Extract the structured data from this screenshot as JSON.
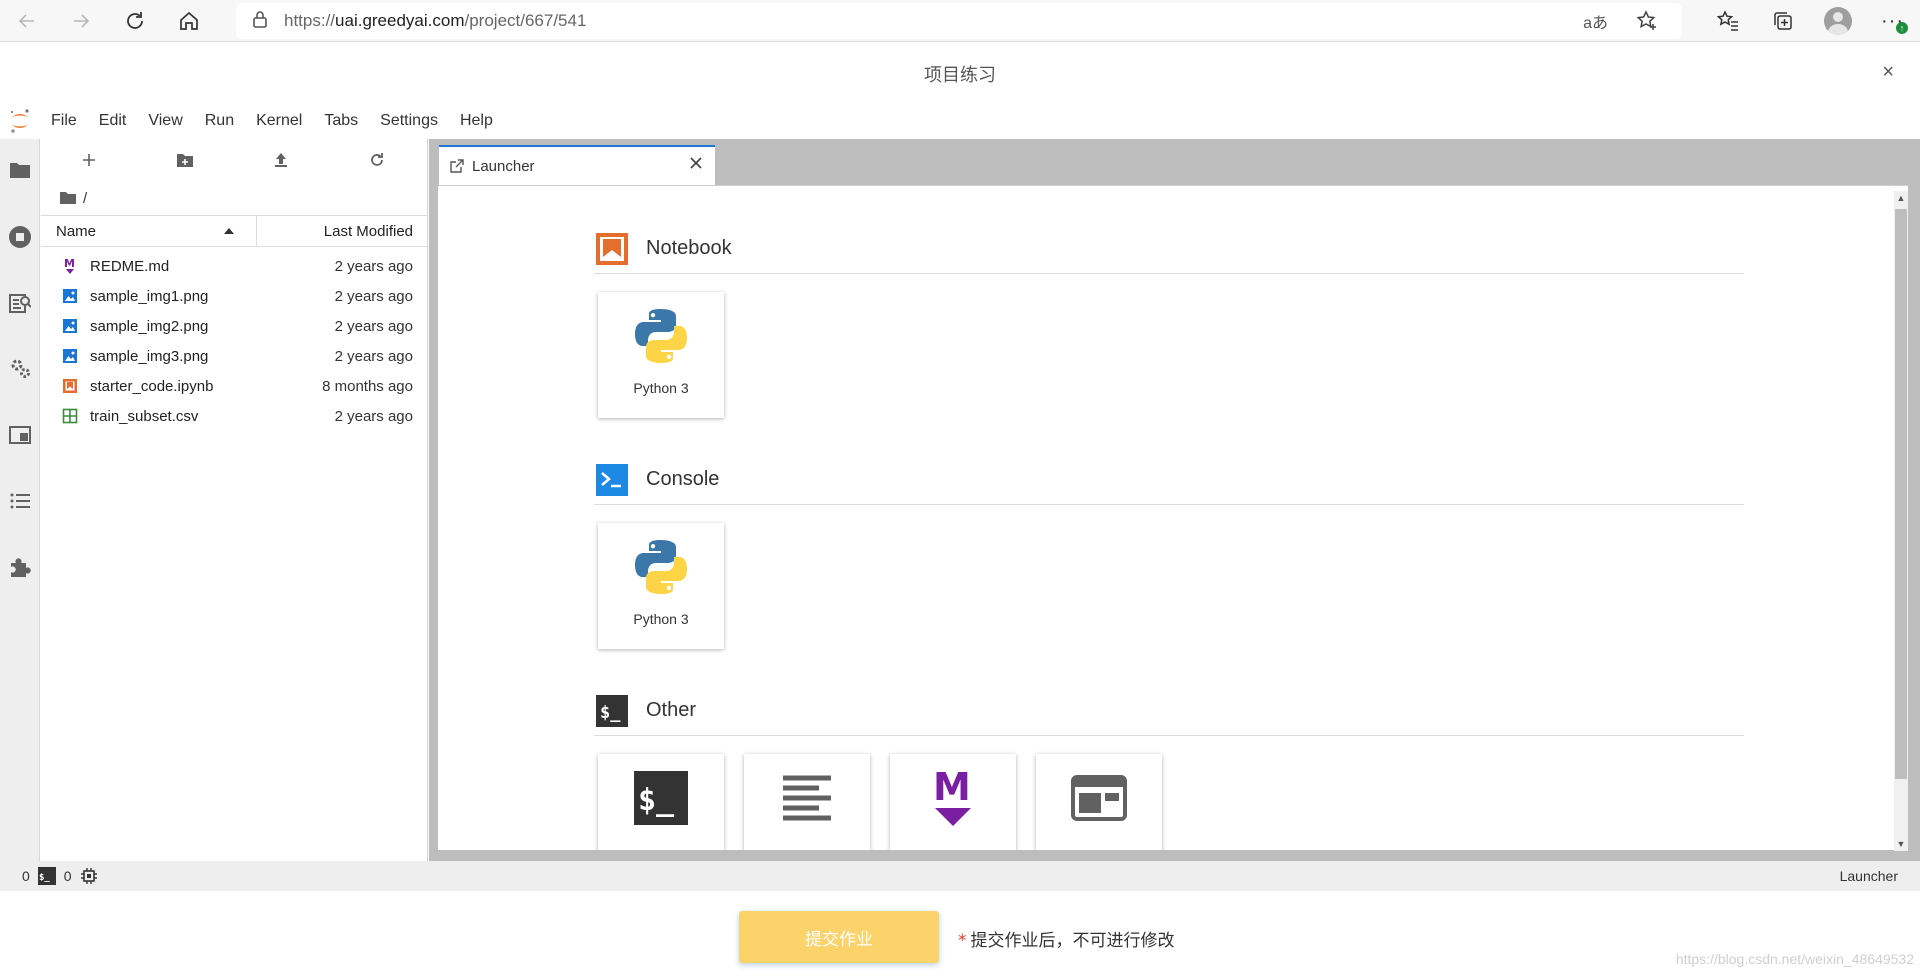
{
  "browser": {
    "url_prefix": "https://",
    "url_host": "uai.greedyai.com",
    "url_path": "/project/667/541",
    "read_aloud_label": "aあ"
  },
  "project": {
    "title": "项目练习",
    "close_glyph": "×"
  },
  "menu": [
    "File",
    "Edit",
    "View",
    "Run",
    "Kernel",
    "Tabs",
    "Settings",
    "Help"
  ],
  "filebrowser": {
    "breadcrumb": "/",
    "col_name": "Name",
    "col_modified": "Last Modified",
    "files": [
      {
        "name": "REDME.md",
        "modified": "2 years ago",
        "type": "markdown"
      },
      {
        "name": "sample_img1.png",
        "modified": "2 years ago",
        "type": "image"
      },
      {
        "name": "sample_img2.png",
        "modified": "2 years ago",
        "type": "image"
      },
      {
        "name": "sample_img3.png",
        "modified": "2 years ago",
        "type": "image"
      },
      {
        "name": "starter_code.ipynb",
        "modified": "8 months ago",
        "type": "notebook"
      },
      {
        "name": "train_subset.csv",
        "modified": "2 years ago",
        "type": "csv"
      }
    ]
  },
  "tab": {
    "label": "Launcher"
  },
  "launcher": {
    "sections": [
      {
        "title": "Notebook",
        "icon": "notebook-icon",
        "cards": [
          {
            "label": "Python 3",
            "icon": "python-logo-icon"
          }
        ]
      },
      {
        "title": "Console",
        "icon": "console-icon",
        "cards": [
          {
            "label": "Python 3",
            "icon": "python-logo-icon"
          }
        ]
      },
      {
        "title": "Other",
        "icon": "other-icon",
        "cards": [
          {
            "label": "",
            "icon": "terminal-icon"
          },
          {
            "label": "",
            "icon": "text-file-icon"
          },
          {
            "label": "",
            "icon": "markdown-icon"
          },
          {
            "label": "",
            "icon": "contextual-help-icon"
          }
        ]
      }
    ]
  },
  "statusbar": {
    "kernels_count": "0",
    "terminals_count": "0",
    "right_label": "Launcher"
  },
  "submit": {
    "button_label": "提交作业",
    "note_star": "*",
    "note_text": "提交作业后，不可进行修改"
  },
  "watermark": "https://blog.csdn.net/weixin_48649532",
  "colors": {
    "accent": "#1976d2",
    "notebook_orange": "#e46e2e",
    "markdown_purple": "#7b1fa2",
    "submit_yellow": "#fcd26b"
  }
}
